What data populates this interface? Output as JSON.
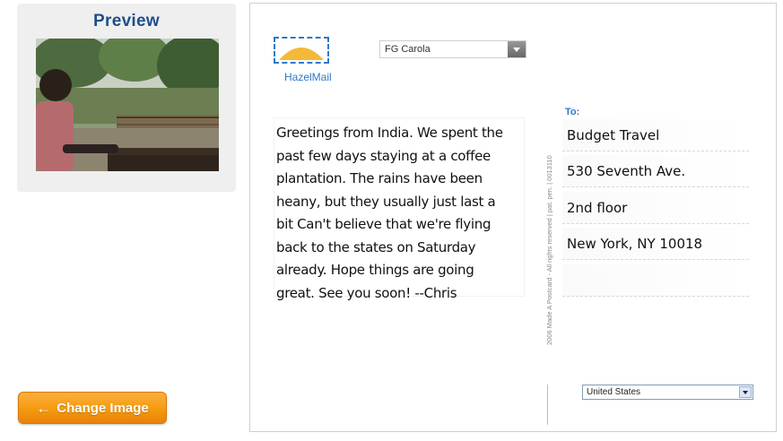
{
  "left": {
    "preview_title": "Preview",
    "change_image_label": "Change Image"
  },
  "postcard": {
    "logo_text": "HazelMail",
    "font_select_value": "FG Carola",
    "message": "Greetings from India. We spent the\npast few days staying at a coffee\nplantation. The rains have been\nheany, but they usually just last a\nbit Can't believe that we're flying\nback to the states on Saturday\nalready. Hope things are going\ngreat. See you soon! --Chris",
    "copyright": "2006 Made A Postcard - All rights reserved | pat. pen. | 0013110",
    "to_label": "To:",
    "address": [
      "Budget Travel",
      "530 Seventh Ave.",
      "2nd floor",
      "New York, NY 10018",
      ""
    ],
    "country_value": "United States"
  },
  "colors": {
    "accent_blue": "#2f78c8",
    "title_blue": "#1f4e8c",
    "button_orange": "#f59a0c"
  },
  "icons": {
    "change_image": "arrow-left-icon",
    "dropdown": "chevron-down-icon"
  }
}
